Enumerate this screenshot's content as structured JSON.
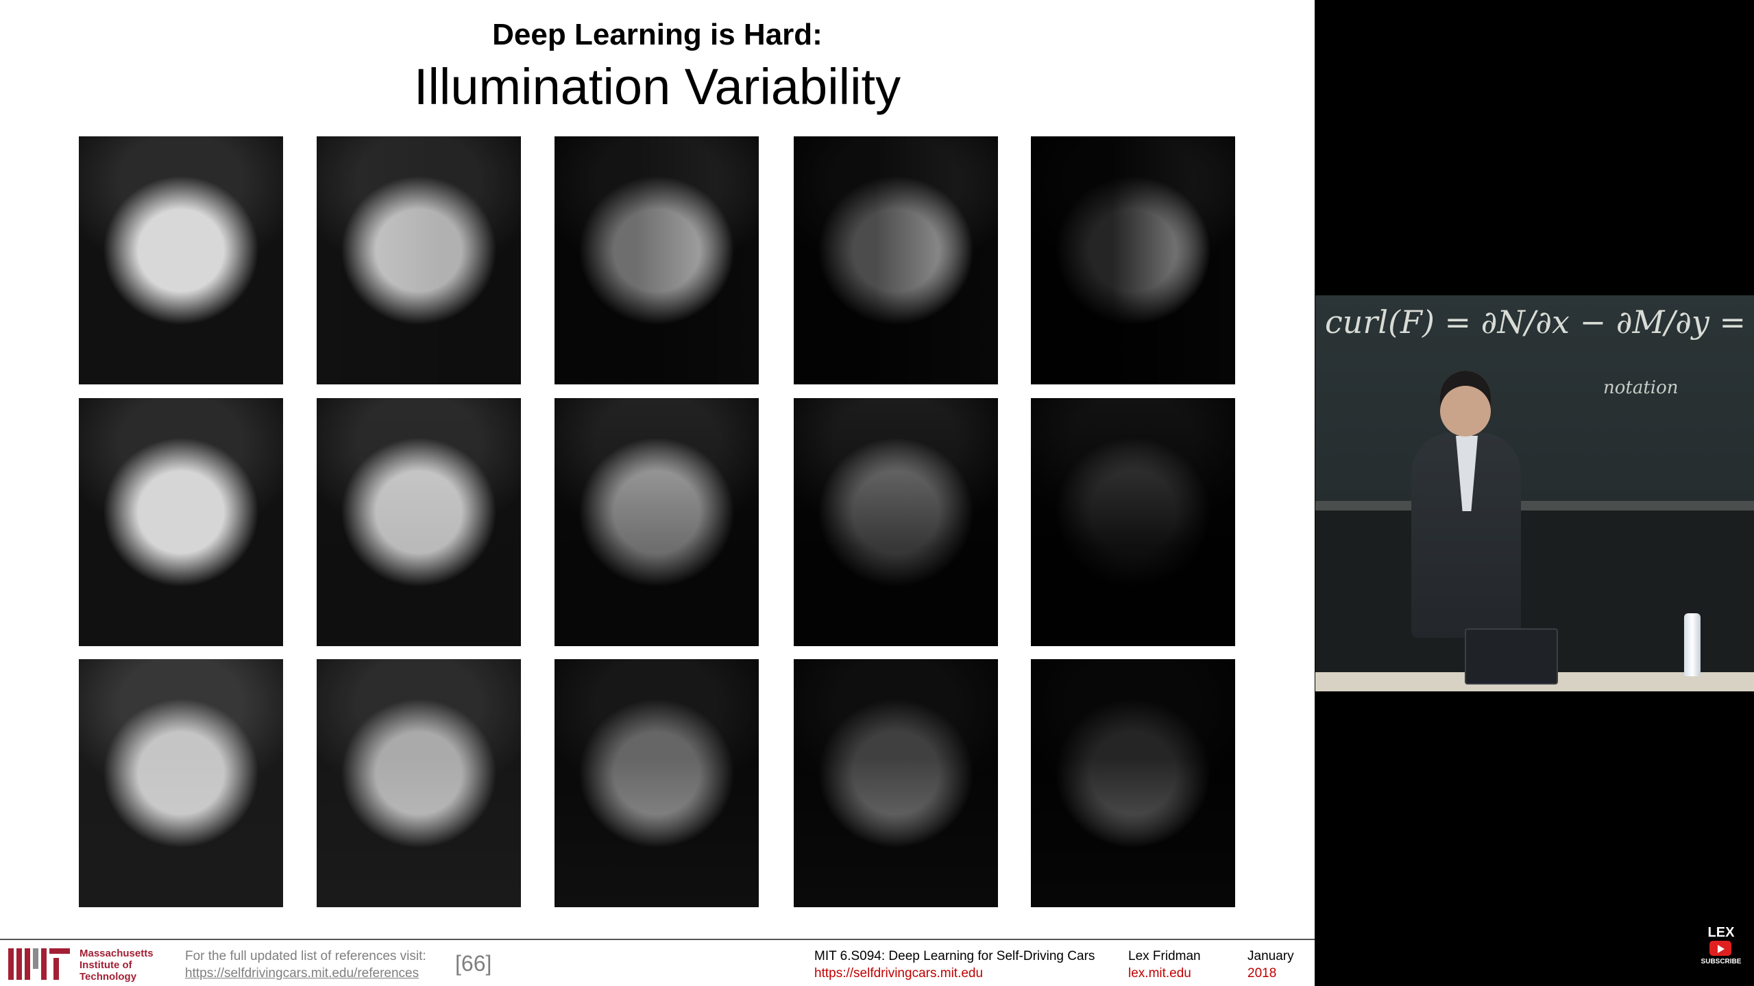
{
  "slide": {
    "title": "Deep Learning is Hard:",
    "subtitle": "Illumination Variability",
    "faces": [
      {
        "bg": "#111",
        "skin": "#d8d8d8",
        "hair": "#2a2a2a",
        "shade": 0.0,
        "dir": "to right",
        "row": 0
      },
      {
        "bg": "#111",
        "skin": "#d0d0d0",
        "hair": "#2a2a2a",
        "shade": 0.15,
        "dir": "to right",
        "row": 0
      },
      {
        "bg": "#0a0a0a",
        "skin": "#c8c8c8",
        "hair": "#222",
        "shade": 0.45,
        "dir": "to left",
        "row": 0
      },
      {
        "bg": "#080808",
        "skin": "#bdbdbd",
        "hair": "#1e1e1e",
        "shade": 0.6,
        "dir": "to left",
        "row": 0
      },
      {
        "bg": "#050505",
        "skin": "#b8b8b8",
        "hair": "#1a1a1a",
        "shade": 0.8,
        "dir": "to left",
        "row": 0
      },
      {
        "bg": "#111",
        "skin": "#d6d6d6",
        "hair": "#2a2a2a",
        "shade": 0.0,
        "dir": "to bottom",
        "row": 1
      },
      {
        "bg": "#111",
        "skin": "#cfcfcf",
        "hair": "#2a2a2a",
        "shade": 0.1,
        "dir": "to bottom",
        "row": 1
      },
      {
        "bg": "#0c0c0c",
        "skin": "#b8b8b8",
        "hair": "#222",
        "shade": 0.4,
        "dir": "to bottom",
        "row": 1
      },
      {
        "bg": "#080808",
        "skin": "#8a8a8a",
        "hair": "#1c1c1c",
        "shade": 0.6,
        "dir": "to bottom",
        "row": 1
      },
      {
        "bg": "#050505",
        "skin": "#4a4a4a",
        "hair": "#121212",
        "shade": 0.8,
        "dir": "to bottom",
        "row": 1
      },
      {
        "bg": "#1a1a1a",
        "skin": "#d0d0d0",
        "hair": "#3a3a3a",
        "shade": 0.05,
        "dir": "to top",
        "row": 2
      },
      {
        "bg": "#1a1a1a",
        "skin": "#c8c8c8",
        "hair": "#333",
        "shade": 0.15,
        "dir": "to top",
        "row": 2
      },
      {
        "bg": "#0f0f0f",
        "skin": "#a9a9a9",
        "hair": "#262626",
        "shade": 0.4,
        "dir": "to top",
        "row": 2
      },
      {
        "bg": "#0a0a0a",
        "skin": "#8f8f8f",
        "hair": "#1e1e1e",
        "shade": 0.55,
        "dir": "to top",
        "row": 2
      },
      {
        "bg": "#060606",
        "skin": "#7c7c7c",
        "hair": "#181818",
        "shade": 0.7,
        "dir": "to top",
        "row": 2
      }
    ]
  },
  "footer": {
    "mit_name": "Massachusetts\nInstitute of\nTechnology",
    "ref_label": "For the full updated list of references visit:",
    "ref_link": "https://selfdrivingcars.mit.edu/references",
    "ref_number": "[66]",
    "course_name": "MIT 6.S094: Deep Learning for Self-Driving Cars",
    "course_link": "https://selfdrivingcars.mit.edu",
    "author_name": "Lex Fridman",
    "author_link": "lex.mit.edu",
    "month": "January",
    "year": "2018"
  },
  "camera": {
    "board_formula": "curl(F) = ∂N/∂x − ∂M/∂y = k̂·(∇×F)",
    "board_note": "notation"
  },
  "brand": {
    "name": "LEX",
    "subscribe": "SUBSCRIBE"
  },
  "colors": {
    "mit_red": "#a31f34",
    "link_red": "#c00000",
    "muted_gray": "#7f7f7f"
  }
}
